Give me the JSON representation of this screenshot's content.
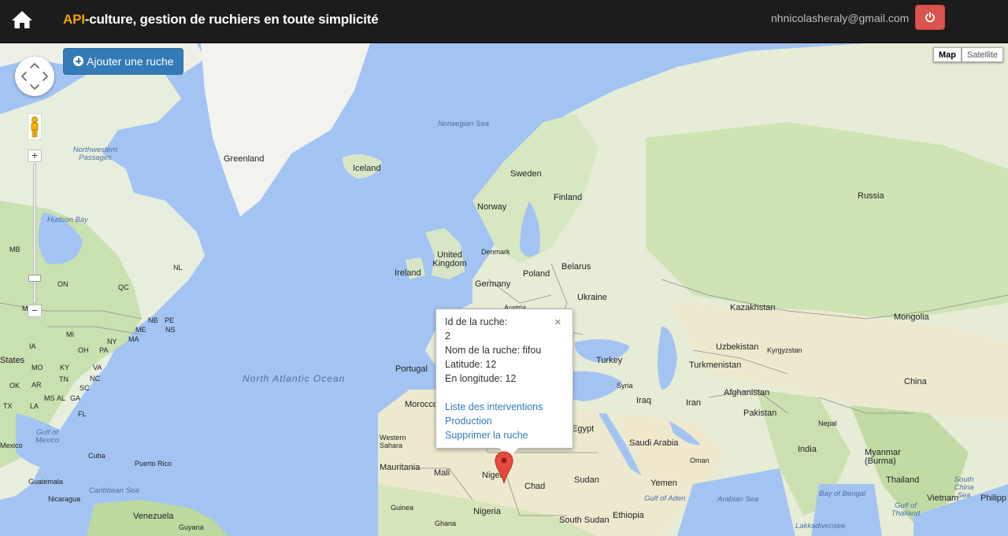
{
  "navbar": {
    "home_icon": "home-icon",
    "brand_accent": "API",
    "brand_rest": "-culture, gestion de ruchiers en toute simplicité",
    "email": "nhnicolasheraly@gmail.com",
    "logout_icon": "power-icon",
    "colors": {
      "background": "#1c1c1c",
      "accent": "#f0a30a",
      "logout": "#d9534f"
    }
  },
  "map": {
    "add_button": "Ajouter une ruche",
    "map_type": [
      "Map",
      "Satellite"
    ],
    "zoom_in": "+",
    "zoom_out": "−",
    "labels": {
      "greenland": "Greenland",
      "iceland": "Iceland",
      "norwegian_sea": "Norwegian Sea",
      "northwestern_passages": "Northwestern Passages",
      "hudson_bay": "Hudson Bay",
      "sweden": "Sweden",
      "finland": "Finland",
      "norway": "Norway",
      "russia": "Russia",
      "denmark": "Denmark",
      "uk": "United Kingdom",
      "ireland": "Ireland",
      "germany": "Germany",
      "poland": "Poland",
      "belarus": "Belarus",
      "ukraine": "Ukraine",
      "austria": "Austria",
      "kazakhstan": "Kazakhstan",
      "mongolia": "Mongolia",
      "uzbekistan": "Uzbekistan",
      "kyrgyzstan": "Kyrgyzstan",
      "turkey": "Turkey",
      "turkmenistan": "Turkmenistan",
      "syria": "Syria",
      "iraq": "Iraq",
      "iran": "Iran",
      "afghanistan": "Afghanistan",
      "pakistan": "Pakistan",
      "china": "China",
      "nepal": "Nepal",
      "india": "India",
      "myanmar": "Myanmar (Burma)",
      "thailand": "Thailand",
      "vietnam": "Vietnam",
      "philippines": "Philipp",
      "south_china_sea": "South China Sea",
      "bay_of_bengal": "Bay of Bengal",
      "gulf_of_thailand": "Gulf of Thailand",
      "arabian_sea": "Arabian Sea",
      "lakshadweep": "Lakkadivensee",
      "gulf_of_aden": "Gulf of Aden",
      "oman": "Oman",
      "yemen": "Yemen",
      "saudi_arabia": "Saudi Arabia",
      "egypt": "Egypt",
      "sudan": "Sudan",
      "south_sudan": "South Sudan",
      "ethiopia": "Ethiopia",
      "chad": "Chad",
      "niger": "Niger",
      "nigeria": "Nigeria",
      "mali": "Mali",
      "mauritania": "Mauritania",
      "western_sahara": "Western Sahara",
      "morocco": "Morocco",
      "portugal": "Portugal",
      "guinea": "Guinea",
      "ghana": "Ghana",
      "north_atlantic": "North Atlantic Ocean",
      "gulf_of_mexico": "Gulf of Mexico",
      "cuba": "Cuba",
      "puerto_rico": "Puerto Rico",
      "guatemala": "Guatemala",
      "nicaragua": "Nicaragua",
      "caribbean_sea": "Caribbean Sea",
      "venezuela": "Venezuela",
      "guyana": "Guyana",
      "states": "States",
      "mexico": "Mexico",
      "mb": "MB",
      "on": "ON",
      "qc": "QC",
      "nl": "NL",
      "mn": "MN",
      "me": "ME",
      "nb": "NB",
      "pe": "PE",
      "ns": "NS",
      "mi": "MI",
      "ny": "NY",
      "ma": "MA",
      "ia": "IA",
      "oh": "OH",
      "pa": "PA",
      "mo": "MO",
      "ky": "KY",
      "va": "VA",
      "ok": "OK",
      "tn": "TN",
      "nc": "NC",
      "ar": "AR",
      "sc": "SC",
      "ms": "MS",
      "al": "AL",
      "ga": "GA",
      "tx": "TX",
      "la": "LA",
      "fl": "FL"
    }
  },
  "popup": {
    "id_label": "Id de la ruche:",
    "id_value": "2",
    "name_line": "Nom de la ruche: fifou",
    "lat_line": "Latitude: 12",
    "lon_line": "En longitude: 12",
    "link_interventions": "Liste des interventions",
    "link_production": "Production",
    "link_delete": "Supprimer la ruche",
    "close_symbol": "×"
  }
}
